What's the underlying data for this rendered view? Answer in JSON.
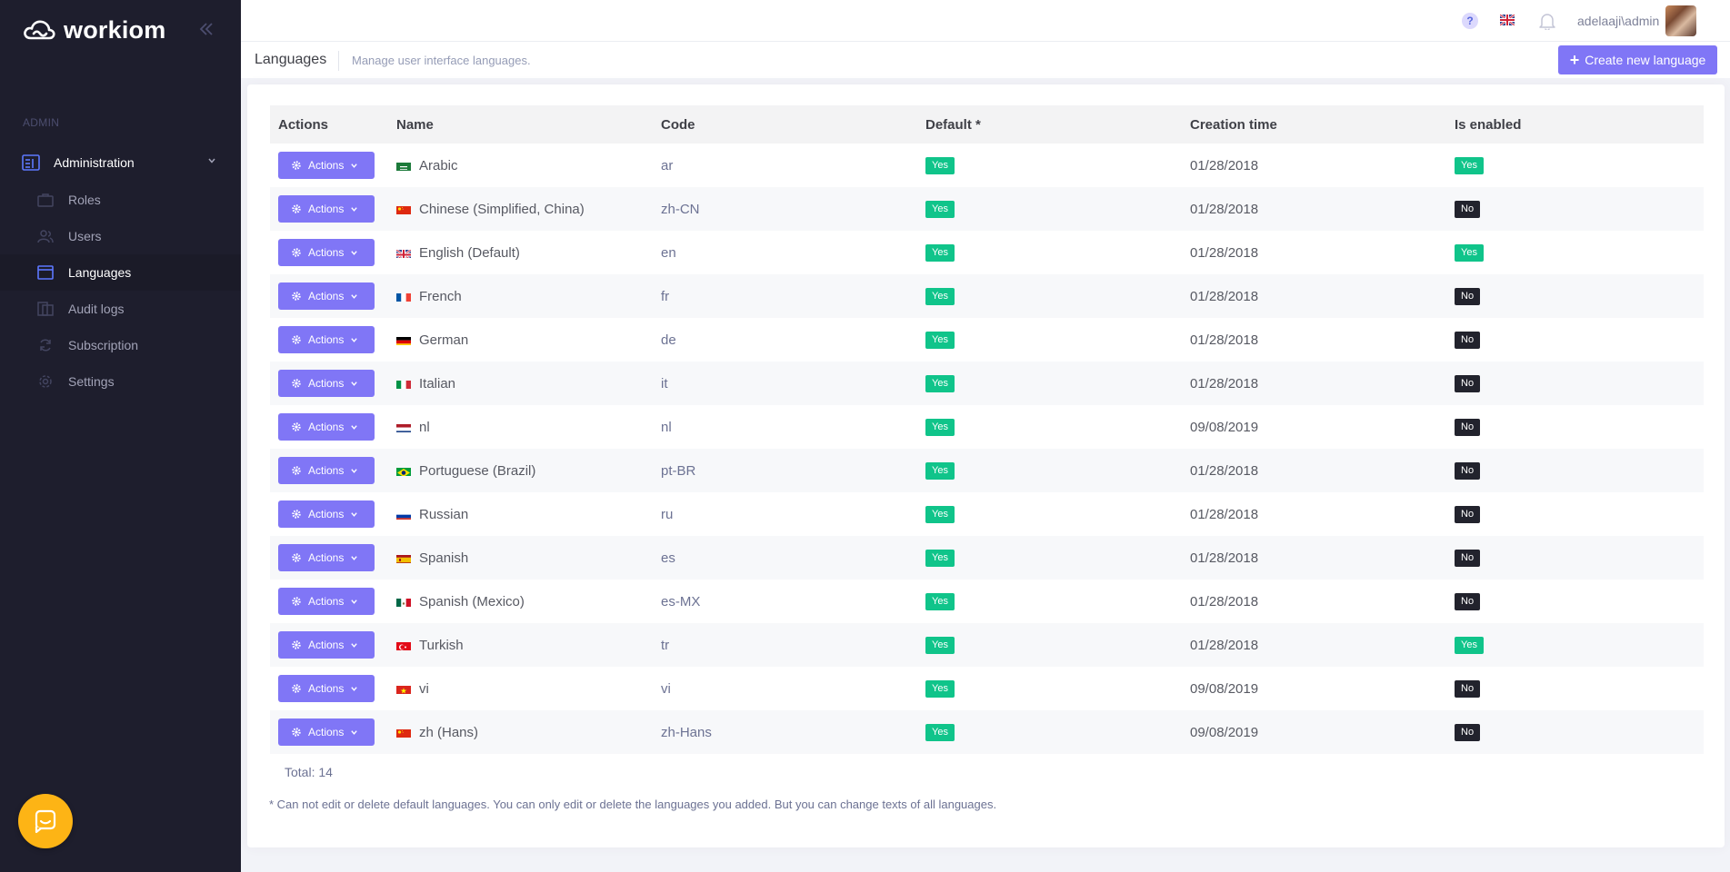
{
  "brand": {
    "name": "workiom"
  },
  "sidebar": {
    "section_label": "ADMIN",
    "parent": {
      "label": "Administration",
      "icon": "admin-panel-icon"
    },
    "items": [
      {
        "label": "Roles",
        "icon": "briefcase-icon",
        "active": false
      },
      {
        "label": "Users",
        "icon": "users-icon",
        "active": false
      },
      {
        "label": "Languages",
        "icon": "window-icon",
        "active": true
      },
      {
        "label": "Audit logs",
        "icon": "audit-logs-icon",
        "active": false
      },
      {
        "label": "Subscription",
        "icon": "refresh-icon",
        "active": false
      },
      {
        "label": "Settings",
        "icon": "gear-icon",
        "active": false
      }
    ]
  },
  "topbar": {
    "help_glyph": "?",
    "username": "adelaaji\\admin"
  },
  "subheader": {
    "title": "Languages",
    "description": "Manage user interface languages.",
    "create_label": "Create new language"
  },
  "table": {
    "headers": [
      "Actions",
      "Name",
      "Code",
      "Default *",
      "Creation time",
      "Is enabled"
    ],
    "action_label": "Actions",
    "rows": [
      {
        "name": "Arabic",
        "flag": "sa",
        "code": "ar",
        "default": "Yes",
        "created": "01/28/2018",
        "enabled": "Yes"
      },
      {
        "name": "Chinese (Simplified, China)",
        "flag": "cn",
        "code": "zh-CN",
        "default": "Yes",
        "created": "01/28/2018",
        "enabled": "No"
      },
      {
        "name": "English (Default)",
        "flag": "gb",
        "code": "en",
        "default": "Yes",
        "created": "01/28/2018",
        "enabled": "Yes"
      },
      {
        "name": "French",
        "flag": "fr",
        "code": "fr",
        "default": "Yes",
        "created": "01/28/2018",
        "enabled": "No"
      },
      {
        "name": "German",
        "flag": "de",
        "code": "de",
        "default": "Yes",
        "created": "01/28/2018",
        "enabled": "No"
      },
      {
        "name": "Italian",
        "flag": "it",
        "code": "it",
        "default": "Yes",
        "created": "01/28/2018",
        "enabled": "No"
      },
      {
        "name": "nl",
        "flag": "nl",
        "code": "nl",
        "default": "Yes",
        "created": "09/08/2019",
        "enabled": "No"
      },
      {
        "name": "Portuguese (Brazil)",
        "flag": "br",
        "code": "pt-BR",
        "default": "Yes",
        "created": "01/28/2018",
        "enabled": "No"
      },
      {
        "name": "Russian",
        "flag": "ru",
        "code": "ru",
        "default": "Yes",
        "created": "01/28/2018",
        "enabled": "No"
      },
      {
        "name": "Spanish",
        "flag": "es",
        "code": "es",
        "default": "Yes",
        "created": "01/28/2018",
        "enabled": "No"
      },
      {
        "name": "Spanish (Mexico)",
        "flag": "mx",
        "code": "es-MX",
        "default": "Yes",
        "created": "01/28/2018",
        "enabled": "No"
      },
      {
        "name": "Turkish",
        "flag": "tr",
        "code": "tr",
        "default": "Yes",
        "created": "01/28/2018",
        "enabled": "Yes"
      },
      {
        "name": "vi",
        "flag": "vn",
        "code": "vi",
        "default": "Yes",
        "created": "09/08/2019",
        "enabled": "No"
      },
      {
        "name": "zh (Hans)",
        "flag": "cn",
        "code": "zh-Hans",
        "default": "Yes",
        "created": "09/08/2019",
        "enabled": "No"
      }
    ]
  },
  "footer": {
    "total": "Total: 14",
    "note": "* Can not edit or delete default languages. You can only edit or delete the languages you added. But you can change texts of all languages."
  },
  "colors": {
    "sidebar_bg": "#1e1e2d",
    "accent": "#8076f6",
    "yes_badge": "#10c48a",
    "no_badge": "#22232d",
    "chat_bubble": "#fdb415"
  }
}
